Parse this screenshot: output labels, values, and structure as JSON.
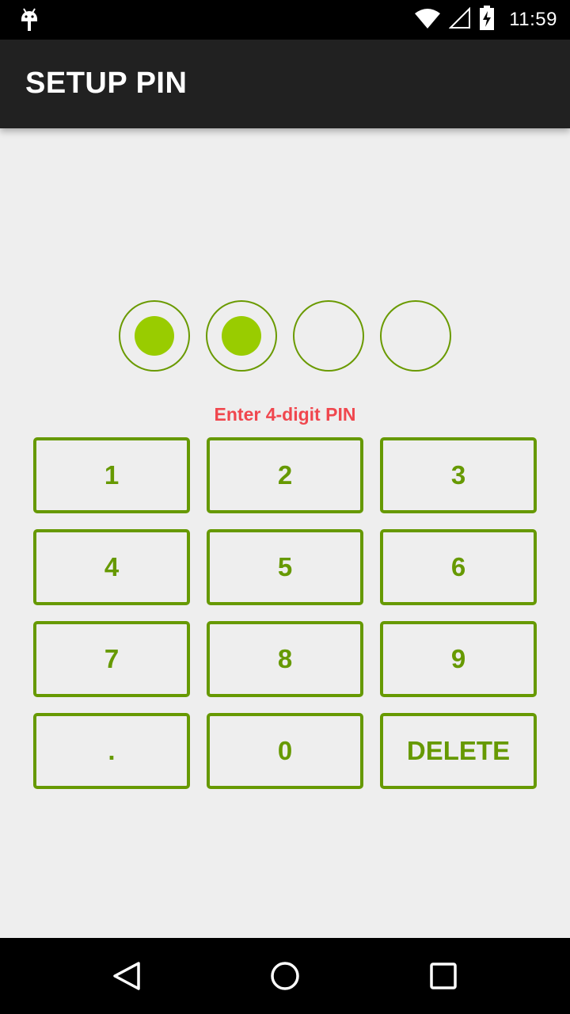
{
  "status_bar": {
    "time": "11:59",
    "icons": [
      "android-debug-icon",
      "wifi-icon",
      "cell-signal-icon",
      "battery-charging-icon"
    ]
  },
  "app_bar": {
    "title": "SETUP PIN"
  },
  "pin": {
    "length": 4,
    "entered": 2,
    "prompt": "Enter 4-digit PIN",
    "prompt_color": "#f0474e"
  },
  "keypad": {
    "keys": [
      "1",
      "2",
      "3",
      "4",
      "5",
      "6",
      "7",
      "8",
      "9",
      ".",
      "0",
      "DELETE"
    ]
  },
  "colors": {
    "accent": "#669900",
    "dot_fill": "#99cc00",
    "app_bar": "#212121",
    "background": "#eeeeee"
  },
  "nav_bar": {
    "icons": [
      "back-icon",
      "home-icon",
      "recents-icon"
    ]
  }
}
